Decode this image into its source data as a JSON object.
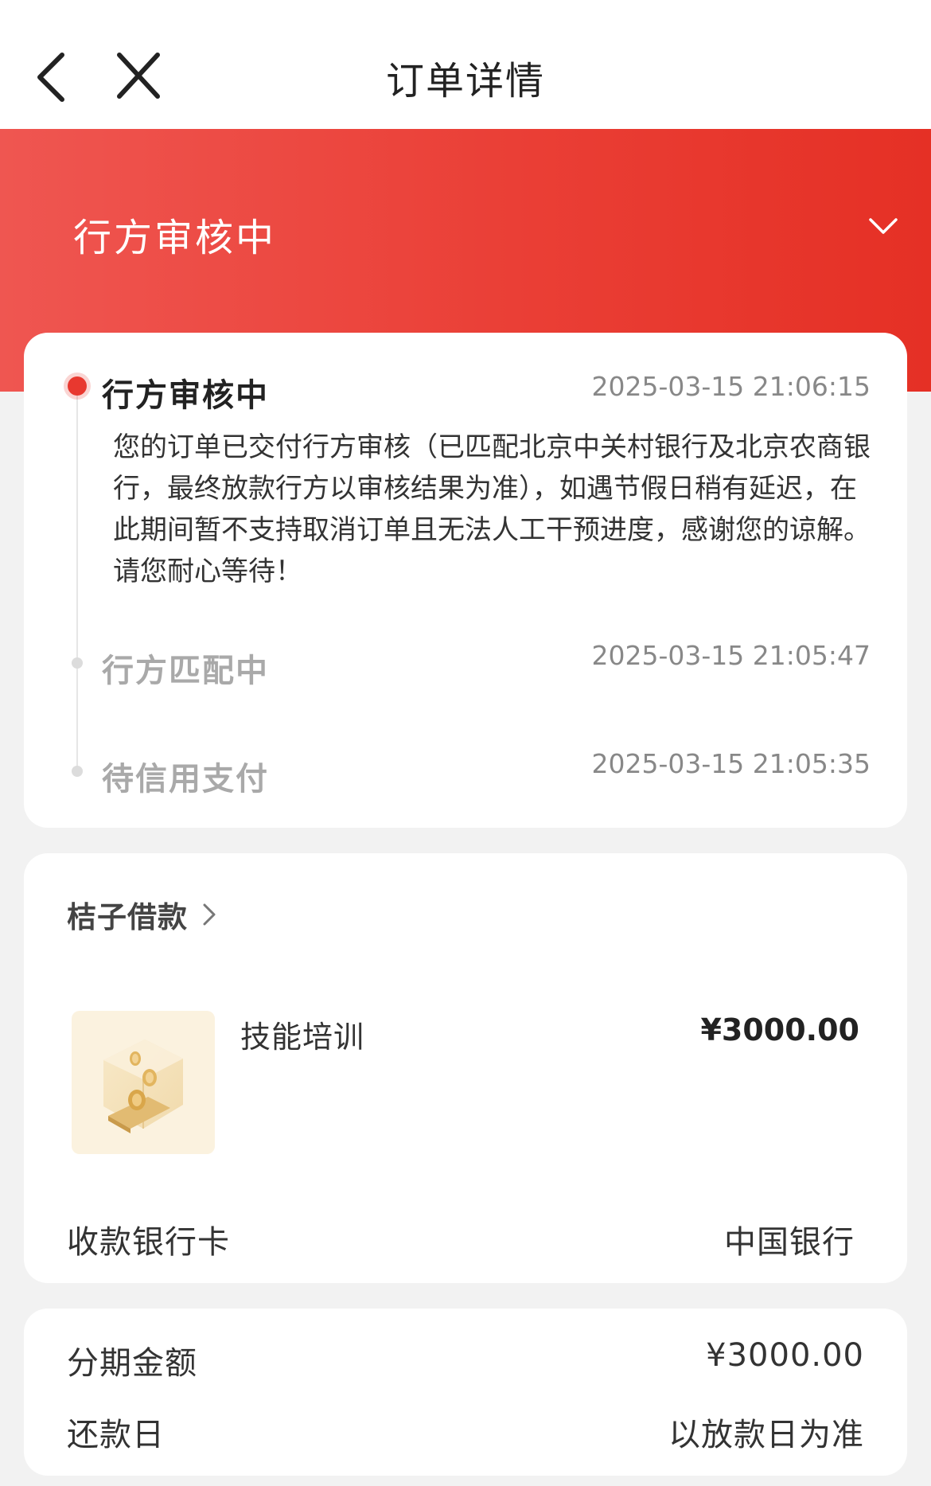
{
  "header": {
    "title": "订单详情",
    "back_icon": "chevron-left-icon",
    "close_icon": "close-icon"
  },
  "status_banner": {
    "title": "行方审核中",
    "expand_icon": "chevron-down-icon",
    "gradient_start": "#ef5651",
    "gradient_end": "#e53025"
  },
  "timeline": {
    "active_color": "#e8382f",
    "steps": [
      {
        "title": "行方审核中",
        "time": "2025-03-15 21:06:15",
        "description": "您的订单已交付行方审核（已匹配北京中关村银行及北京农商银行，最终放款行方以审核结果为准），如遇节假日稍有延迟，在此期间暂不支持取消订单且无法人工干预进度，感谢您的谅解。请您耐心等待！",
        "active": true
      },
      {
        "title": "行方匹配中",
        "time": "2025-03-15 21:05:47",
        "active": false
      },
      {
        "title": "待信用支付",
        "time": "2025-03-15 21:05:35",
        "active": false
      }
    ]
  },
  "order": {
    "merchant_name": "桔子借款",
    "merchant_chevron_icon": "chevron-right-icon",
    "product": {
      "image_icon": "coin-box-icon",
      "name": "技能培训",
      "price": "¥3000.00"
    },
    "bank_card": {
      "label": "收款银行卡",
      "value": "中国银行"
    }
  },
  "installment": {
    "amount_label": "分期金额",
    "amount_value": "¥3000.00",
    "repay_label": "还款日",
    "repay_value": "以放款日为准"
  }
}
